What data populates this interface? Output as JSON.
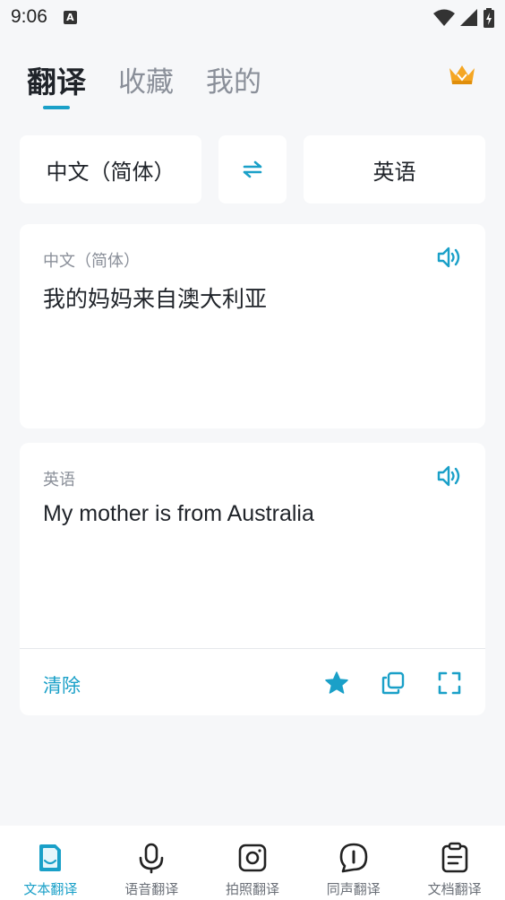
{
  "status_bar": {
    "time": "9:06",
    "notif_glyph": "A"
  },
  "top_tabs": [
    {
      "label": "翻译",
      "active": true
    },
    {
      "label": "收藏",
      "active": false
    },
    {
      "label": "我的",
      "active": false
    }
  ],
  "lang_bar": {
    "source": "中文（简体）",
    "target": "英语"
  },
  "source_card": {
    "label": "中文（简体）",
    "text": "我的妈妈来自澳大利亚"
  },
  "target_card": {
    "label": "英语",
    "text": "My mother is from Australia",
    "clear_label": "清除"
  },
  "bottom_nav": [
    {
      "label": "文本翻译",
      "icon": "document-icon",
      "active": true
    },
    {
      "label": "语音翻译",
      "icon": "microphone-icon",
      "active": false
    },
    {
      "label": "拍照翻译",
      "icon": "camera-icon",
      "active": false
    },
    {
      "label": "同声翻译",
      "icon": "chat-bubble-icon",
      "active": false
    },
    {
      "label": "文档翻译",
      "icon": "clipboard-icon",
      "active": false
    }
  ],
  "colors": {
    "accent": "#1aa0c8",
    "background": "#f6f7f9",
    "crown": "#f5a623"
  }
}
